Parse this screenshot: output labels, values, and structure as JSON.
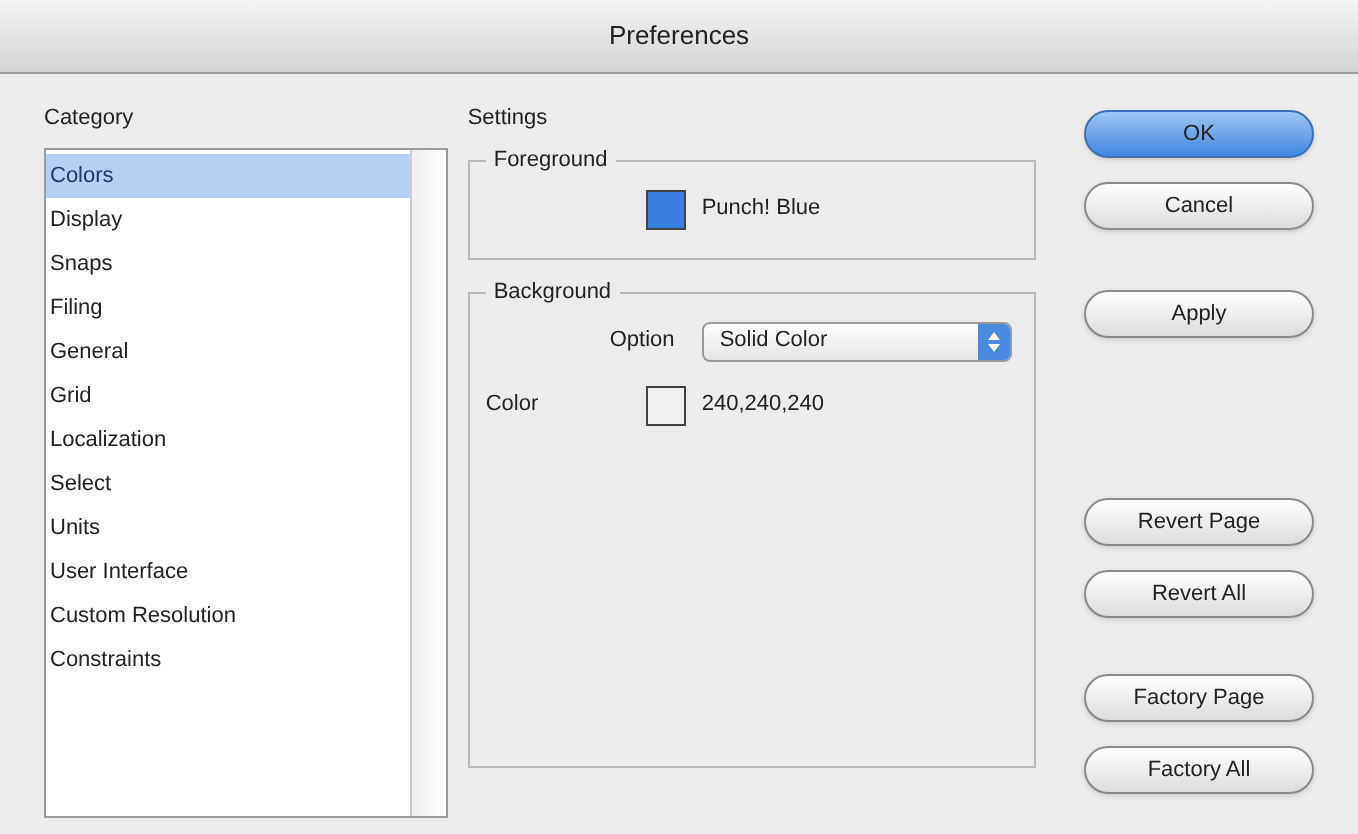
{
  "window": {
    "title": "Preferences"
  },
  "category": {
    "label": "Category",
    "items": [
      {
        "label": "Colors",
        "selected": true
      },
      {
        "label": "Display",
        "selected": false
      },
      {
        "label": "Snaps",
        "selected": false
      },
      {
        "label": "Filing",
        "selected": false
      },
      {
        "label": "General",
        "selected": false
      },
      {
        "label": "Grid",
        "selected": false
      },
      {
        "label": "Localization",
        "selected": false
      },
      {
        "label": "Select",
        "selected": false
      },
      {
        "label": "Units",
        "selected": false
      },
      {
        "label": "User Interface",
        "selected": false
      },
      {
        "label": "Custom Resolution",
        "selected": false
      },
      {
        "label": "Constraints",
        "selected": false
      }
    ]
  },
  "settings": {
    "label": "Settings",
    "foreground": {
      "legend": "Foreground",
      "swatch": {
        "color": "#3a7fe0",
        "value": "Punch! Blue"
      }
    },
    "background": {
      "legend": "Background",
      "option_label": "Option",
      "option_value": "Solid Color",
      "color_label": "Color",
      "swatch": {
        "color": "#f0f0f0",
        "value": "240,240,240"
      }
    }
  },
  "button_groups": [
    [
      {
        "label": "OK",
        "default": true
      },
      {
        "label": "Cancel",
        "default": false
      }
    ],
    [
      {
        "label": "Apply",
        "default": false
      }
    ],
    [
      {
        "label": "Revert Page",
        "default": false
      },
      {
        "label": "Revert All",
        "default": false
      }
    ],
    [
      {
        "label": "Factory Page",
        "default": false
      },
      {
        "label": "Factory All",
        "default": false
      }
    ]
  ]
}
